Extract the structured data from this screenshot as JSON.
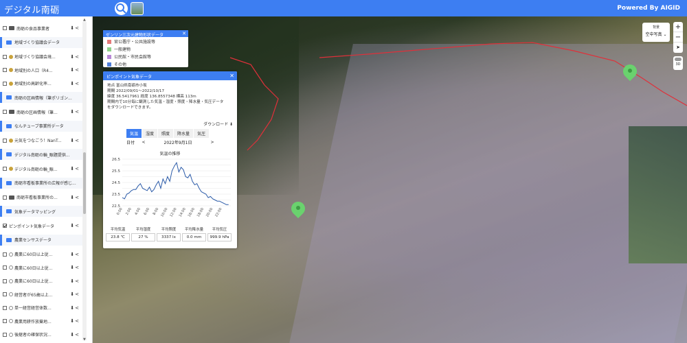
{
  "app": {
    "title": "デジタル南砺",
    "powered_by": "Powered By AIGID"
  },
  "sidebar": {
    "rows": [
      {
        "type": "item",
        "checked": false,
        "icon": "folder",
        "label": "南砺の食品事業者",
        "actions": "⬇<"
      },
      {
        "type": "category",
        "label": "地域づくり協議会データ"
      },
      {
        "type": "item",
        "checked": false,
        "icon": "dot",
        "label": "地域づくり協議会境...",
        "actions": "⬇<"
      },
      {
        "type": "item",
        "checked": false,
        "icon": "dot",
        "label": "地域別の人口（R4...",
        "actions": "⬇<"
      },
      {
        "type": "item",
        "checked": false,
        "icon": "dot",
        "label": "地域別の高齢化率...",
        "actions": "⬇<"
      },
      {
        "type": "category",
        "label": "南砺の区画情報（筆ポリゴン..."
      },
      {
        "type": "item",
        "checked": false,
        "icon": "folder",
        "label": "南砺の区画情報（筆...",
        "actions": "⬇<"
      },
      {
        "type": "category",
        "label": "なんチューブ事業所データ"
      },
      {
        "type": "item",
        "checked": false,
        "icon": "dot",
        "label": "元気をつなごう！NanT...",
        "actions": "⬇<"
      },
      {
        "type": "category",
        "label": "デジタル南砺の輪_賑題提供..."
      },
      {
        "type": "item",
        "checked": false,
        "icon": "dot",
        "label": "デジタル南砺の輪_賑...",
        "actions": "⬇<"
      },
      {
        "type": "category",
        "label": "南砺市看板事業所の広報が感じ..."
      },
      {
        "type": "item",
        "checked": false,
        "icon": "folder",
        "label": "南砺市看板事業所の...",
        "actions": "⬇<"
      },
      {
        "type": "category",
        "label": "気象データマッピング"
      },
      {
        "type": "item",
        "checked": true,
        "icon": "none",
        "label": "ピンポイント気象データ",
        "actions": "⬇<"
      },
      {
        "type": "category",
        "label": "農業センサスデータ"
      },
      {
        "type": "item",
        "checked": false,
        "icon": "circle",
        "label": "農業に60日以上従...",
        "actions": "⬇<"
      },
      {
        "type": "item",
        "checked": false,
        "icon": "circle",
        "label": "農業に60日以上従...",
        "actions": "⬇<"
      },
      {
        "type": "item",
        "checked": false,
        "icon": "circle",
        "label": "農業に60日以上従...",
        "actions": "⬇<"
      },
      {
        "type": "item",
        "checked": false,
        "icon": "circle",
        "label": "経営者が65歳以上...",
        "actions": "⬇<"
      },
      {
        "type": "item",
        "checked": false,
        "icon": "circle",
        "label": "単一経営経営体数...",
        "actions": "⬇<"
      },
      {
        "type": "item",
        "checked": false,
        "icon": "circle",
        "label": "農業用耕作放棄地...",
        "actions": "⬇<"
      },
      {
        "type": "item",
        "checked": false,
        "icon": "circle",
        "label": "後継者の確保状況...",
        "actions": "⬇<"
      },
      {
        "type": "item",
        "checked": false,
        "icon": "circle",
        "label": "農業経営管理者...",
        "actions": "⬇<"
      }
    ]
  },
  "map_controls": {
    "basemap_title": "背景",
    "basemap_selected": "空中写真 ⌄",
    "zoom_in": "+",
    "zoom_out": "−",
    "compass": "➤",
    "toggle_3d": "3D"
  },
  "legend": {
    "title": "ゼンリン三次元建物形状データ",
    "close": "✕",
    "items": [
      {
        "label": "官公署庁・公共施設等",
        "color": "#e57a7a"
      },
      {
        "label": "一般建物",
        "color": "#8fd18a"
      },
      {
        "label": "公民館・市民会館等",
        "color": "#b887d6"
      },
      {
        "label": "その他",
        "color": "#4f7fd9"
      }
    ]
  },
  "panel": {
    "title": "ピンポイント気象データ",
    "close": "✕",
    "location_line": "地点  富山県南砺市小坂",
    "period_line": "期間  2022/09/01〜2022/10/17",
    "coords_line": "緯度  36.5417961  経度  136.8557348  標高  113m",
    "desc_line1": "期間内で10分毎に観測した気温・湿度・照度・降水量・気圧データ",
    "desc_line2": "をダウンロードできます。",
    "download": "ダウンロード ⬇",
    "tabs": [
      "気温",
      "湿度",
      "照度",
      "降水量",
      "気圧"
    ],
    "date_label": "日付",
    "date_prev": "<",
    "date_value": "2022年9月1日",
    "date_next": ">",
    "chart_heading": "気温の推移",
    "stats": [
      {
        "label": "平均気温",
        "value": "23.8 ℃"
      },
      {
        "label": "平均湿度",
        "value": "27 %"
      },
      {
        "label": "平均照度",
        "value": "3337 lx"
      },
      {
        "label": "平均降水量",
        "value": "0.0 mm"
      },
      {
        "label": "平均気圧",
        "value": "999.9 hPa"
      }
    ]
  },
  "chart_data": {
    "type": "line",
    "title": "気温の推移",
    "xlabel": "",
    "ylabel": "",
    "ylim": [
      22.5,
      26.5
    ],
    "yticks": [
      22.5,
      23.0,
      23.5,
      24.0,
      24.5,
      25.0,
      25.5,
      26.0,
      26.5
    ],
    "x_ticks": [
      "0:00",
      "2:00",
      "4:00",
      "6:00",
      "8:00",
      "10:00",
      "12:00",
      "14:00",
      "16:00",
      "18:00",
      "20:00",
      "22:00"
    ],
    "x_hours": [
      0,
      0.5,
      1,
      1.5,
      2,
      2.5,
      3,
      3.5,
      4,
      4.5,
      5,
      5.5,
      6,
      6.5,
      7,
      7.5,
      8,
      8.5,
      9,
      9.5,
      10,
      10.5,
      11,
      11.5,
      12,
      12.5,
      13,
      13.5,
      14,
      14.5,
      15,
      15.5,
      16,
      16.5,
      17,
      17.5,
      18,
      18.5,
      19,
      19.5,
      20,
      20.5,
      21,
      21.5,
      22,
      22.5,
      23,
      23.5
    ],
    "series": [
      {
        "color": "#2a5aa8",
        "values": [
          23.2,
          23.1,
          23.5,
          23.6,
          23.8,
          23.9,
          23.9,
          24.2,
          24.4,
          24.0,
          23.9,
          23.8,
          24.1,
          23.7,
          23.9,
          24.3,
          24.6,
          24.0,
          24.8,
          24.4,
          25.0,
          24.6,
          25.5,
          25.9,
          26.2,
          25.4,
          25.8,
          25.6,
          25.0,
          24.9,
          25.2,
          24.6,
          24.3,
          24.4,
          24.0,
          23.7,
          23.6,
          23.5,
          23.2,
          23.3,
          23.1,
          23.0,
          22.9,
          22.9,
          22.8,
          22.7,
          22.6,
          22.6
        ]
      }
    ]
  }
}
